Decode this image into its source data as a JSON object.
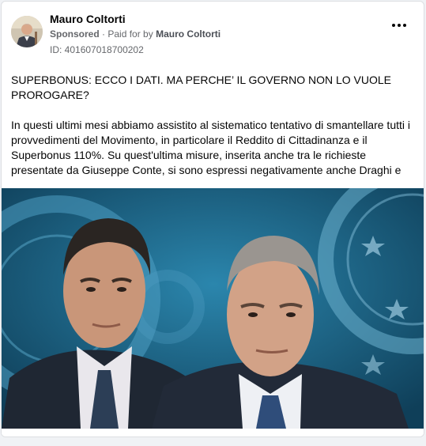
{
  "post": {
    "author": "Mauro Coltorti",
    "sponsored_label": "Sponsored",
    "separator": "·",
    "paid_for_by_label": "Paid for by",
    "payer": "Mauro Coltorti",
    "ad_id": "ID: 401607018700202",
    "headline": "SUPERBONUS: ECCO I DATI. MA PERCHE’ IL GOVERNO NON LO VUOLE PROROGARE?",
    "body": "In questi ultimi mesi abbiamo assistito al sistematico tentativo di smantellare tutti i provvedimenti del Movimento, in particolare il Reddito di Cittadinanza e il Superbonus 110%. Su quest'ultima misure, inserita anche tra le richieste presentate da Giuseppe Conte, si sono espressi negativamente anche Draghi e il..."
  },
  "icons": {
    "more": "more-options-icon",
    "avatar": "profile-photo"
  },
  "colors": {
    "name": "#050505",
    "meta": "#65676b",
    "photo_background": "#1b5c7d"
  }
}
